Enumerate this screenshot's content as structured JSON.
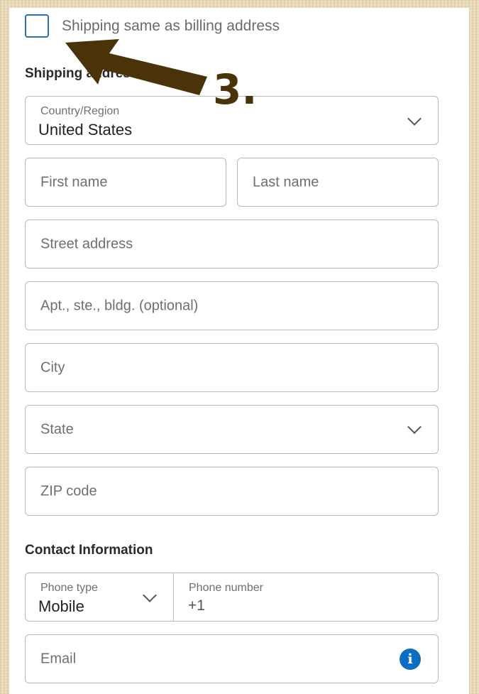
{
  "billing_toggle": {
    "label": "Shipping same as billing address",
    "checked": false
  },
  "shipping": {
    "title": "Shipping address",
    "country": {
      "label": "Country/Region",
      "value": "United States"
    },
    "first_name": {
      "placeholder": "First name"
    },
    "last_name": {
      "placeholder": "Last name"
    },
    "street": {
      "placeholder": "Street address"
    },
    "apt": {
      "placeholder": "Apt., ste., bldg. (optional)"
    },
    "city": {
      "placeholder": "City"
    },
    "state": {
      "placeholder": "State"
    },
    "zip": {
      "placeholder": "ZIP code"
    }
  },
  "contact": {
    "title": "Contact Information",
    "phone_type": {
      "label": "Phone type",
      "value": "Mobile"
    },
    "phone_number": {
      "label": "Phone number",
      "value": "+1"
    },
    "email": {
      "placeholder": "Email"
    },
    "info_icon": "i"
  },
  "annotation": {
    "text": "3.",
    "color": "#4a3308"
  },
  "colors": {
    "accent": "#0a6fc2",
    "checkbox_border": "#2c6fb3"
  }
}
